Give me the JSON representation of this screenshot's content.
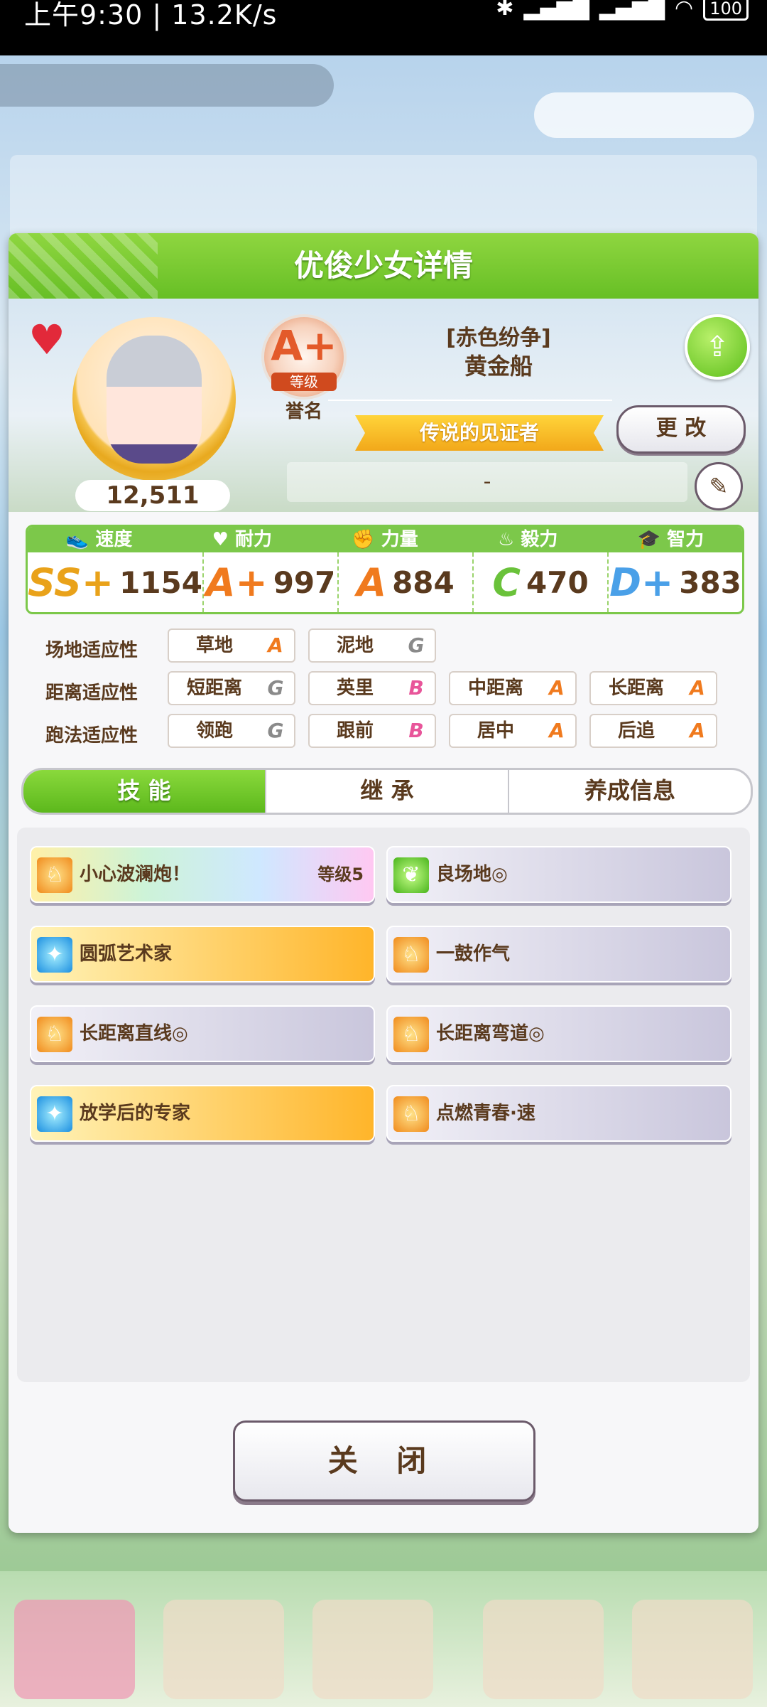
{
  "status_bar": {
    "time_speed": "上午9:30 | 13.2K/s",
    "battery": "100"
  },
  "dialog": {
    "title": "优俊少女详情",
    "close_label": "关 闭"
  },
  "profile": {
    "fans": "12,511",
    "rank_grade": "A+",
    "rank_label": "等级",
    "rank_sub": "誉名",
    "character_title": "[赤色纷争]",
    "character_name": "黄金船",
    "honor_title": "传说的见证者",
    "change_label": "更 改",
    "motto": "-"
  },
  "stats": {
    "headers": [
      "速度",
      "耐力",
      "力量",
      "毅力",
      "智力"
    ],
    "values": [
      {
        "grade": "SS+",
        "value": "1154",
        "color": "#e9a21a"
      },
      {
        "grade": "A+",
        "value": "997",
        "color": "#f07a1e"
      },
      {
        "grade": "A",
        "value": "884",
        "color": "#f07a1e"
      },
      {
        "grade": "C",
        "value": "470",
        "color": "#6ac23a"
      },
      {
        "grade": "D+",
        "value": "383",
        "color": "#4aa0e8"
      }
    ]
  },
  "aptitude": {
    "track": {
      "label": "场地适应性",
      "items": [
        {
          "name": "草地",
          "grade": "A"
        },
        {
          "name": "泥地",
          "grade": "G"
        }
      ]
    },
    "distance": {
      "label": "距离适应性",
      "items": [
        {
          "name": "短距离",
          "grade": "G"
        },
        {
          "name": "英里",
          "grade": "B"
        },
        {
          "name": "中距离",
          "grade": "A"
        },
        {
          "name": "长距离",
          "grade": "A"
        }
      ]
    },
    "style": {
      "label": "跑法适应性",
      "items": [
        {
          "name": "领跑",
          "grade": "G"
        },
        {
          "name": "跟前",
          "grade": "B"
        },
        {
          "name": "居中",
          "grade": "A"
        },
        {
          "name": "后追",
          "grade": "A"
        }
      ]
    }
  },
  "tabs": [
    "技 能",
    "继 承",
    "养成信息"
  ],
  "skills": [
    {
      "name": "小心波澜炮！",
      "level": "等级5",
      "style": "rainbow",
      "icon": "horse-icon"
    },
    {
      "name": "良场地◎",
      "level": "",
      "style": "normal",
      "icon": "turf-icon"
    },
    {
      "name": "圆弧艺术家",
      "level": "",
      "style": "gold",
      "icon": "sparkle-icon"
    },
    {
      "name": "一鼓作气",
      "level": "",
      "style": "normal",
      "icon": "horse-icon"
    },
    {
      "name": "长距离直线◎",
      "level": "",
      "style": "normal",
      "icon": "horse-icon"
    },
    {
      "name": "长距离弯道◎",
      "level": "",
      "style": "normal",
      "icon": "horse-icon"
    },
    {
      "name": "放学后的专家",
      "level": "",
      "style": "gold",
      "icon": "sparkle-icon"
    },
    {
      "name": "点燃青春·速",
      "level": "",
      "style": "normal",
      "icon": "horse-icon"
    }
  ],
  "colors": {
    "green": "#67bf25",
    "brown_text": "#5a3a1e",
    "grade_A": "#f07a1e",
    "grade_B": "#e8559a",
    "grade_G": "#8a8a8a"
  }
}
